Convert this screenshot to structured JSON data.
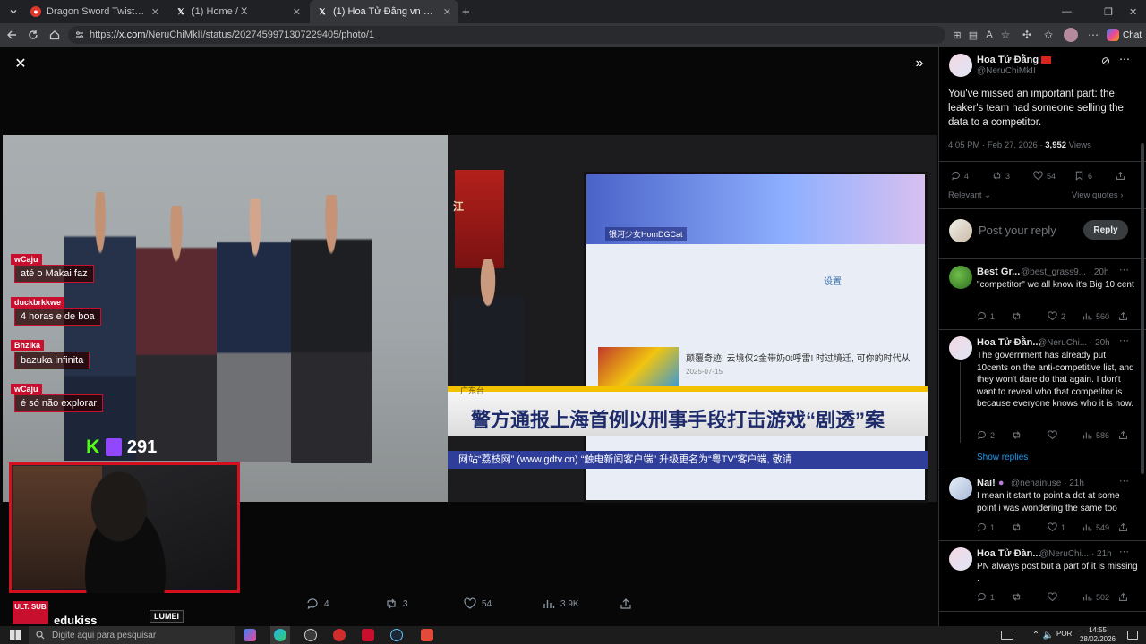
{
  "browser": {
    "tabs": [
      {
        "title": "Dragon Sword Twist: Webzen page...",
        "icon": "webzen-icon",
        "color": "#e03a2f"
      },
      {
        "title": "(1) Home / X",
        "icon": "x-logo-icon",
        "color": "#ffffff"
      },
      {
        "title": "(1) Hoa Tử Đằng vn on X: \"@Pirat...",
        "icon": "x-logo-icon",
        "color": "#ffffff"
      }
    ],
    "url_prefix": "https://",
    "url_host": "x.com",
    "url_path": "/NeruChiMkII/status/2027459971307229405/photo/1",
    "chat_label": "Chat"
  },
  "stream": {
    "chat": [
      {
        "user": "wCaju",
        "message": "até o Makai faz"
      },
      {
        "user": "duckbrkkwe",
        "message": "4 horas e de boa"
      },
      {
        "user": "Bhzika",
        "message": "bazuka infinita"
      },
      {
        "user": "wCaju",
        "message": "é só não explorar"
      }
    ],
    "viewer_count": "291",
    "streamer_name": "edukiss",
    "brand_badge": "ULT. SUB",
    "brand_logo": "LUMEI",
    "news": {
      "headline": "警方通报上海首例以刑事手段打击游戏“剧透”案",
      "tag": "广东台",
      "ticker": "网站“荔枝网” (www.gdtv.cn) “触电新闻客户端” 升级更名为“粤TV”客户端, 敬请",
      "site_title": "银河少女HomDGCat",
      "site_nav": "设置",
      "card_text": "颠覆奇迹! 云境仅2金带奶0t呼雷! 时过境迁, 可你的时代从",
      "card_date": "2025-07-15",
      "wall_text": "江"
    }
  },
  "actions": {
    "replies": "4",
    "reposts": "3",
    "likes": "54",
    "views": "3.9K"
  },
  "post": {
    "name": "Hoa Tử Đằng",
    "handle": "@NeruChiMkII",
    "text": "You've missed an important part: the leaker's team had someone selling the data to a competitor.",
    "time": "4:05 PM · Feb 27, 2026 · ",
    "views_count": "3,952",
    "views_label": " Views",
    "stats": {
      "replies": "4",
      "reposts": "3",
      "likes": "54",
      "bookmarks": "6"
    },
    "relevant_label": "Relevant",
    "view_quotes_label": "View quotes",
    "reply_placeholder": "Post your reply",
    "reply_button": "Reply"
  },
  "replies": [
    {
      "name": "Best Gr...",
      "handle": "@best_grass9...",
      "time": "· 20h",
      "text": "\"competitor\" we all know it's Big 10 cent",
      "stats": {
        "replies": "1",
        "reposts": "",
        "likes": "2",
        "views": "560"
      }
    },
    {
      "name": "Hoa Tử Đằn...",
      "handle": "@NeruChi...",
      "time": "· 20h",
      "text": "The government has already put 10cents on the anti-competitive list, and they won't dare do that again. I don't want to reveal who that competitor is because everyone knows who it is now.",
      "stats": {
        "replies": "2",
        "reposts": "",
        "likes": "",
        "views": "586"
      },
      "show_replies": "Show replies"
    },
    {
      "name": "Nai!",
      "handle": "@nehainuse",
      "time": "· 21h",
      "text": "I mean it start to point a dot at some point i was wondering the same too",
      "stats": {
        "replies": "1",
        "reposts": "",
        "likes": "1",
        "views": "549"
      }
    },
    {
      "name": "Hoa Tử Đàn...",
      "handle": "@NeruChi...",
      "time": "· 21h",
      "text": "PN always post but a part of it is missing .",
      "stats": {
        "replies": "1",
        "reposts": "",
        "likes": "",
        "views": "502"
      }
    }
  ],
  "taskbar": {
    "search_placeholder": "Digite aqui para pesquisar",
    "language": "POR",
    "time": "14:55",
    "date": "28/02/2026"
  },
  "colors": {
    "accent_red": "#c8102e",
    "x_background": "#000000",
    "x_muted": "#71767b",
    "link_blue": "#1d9bf0"
  }
}
